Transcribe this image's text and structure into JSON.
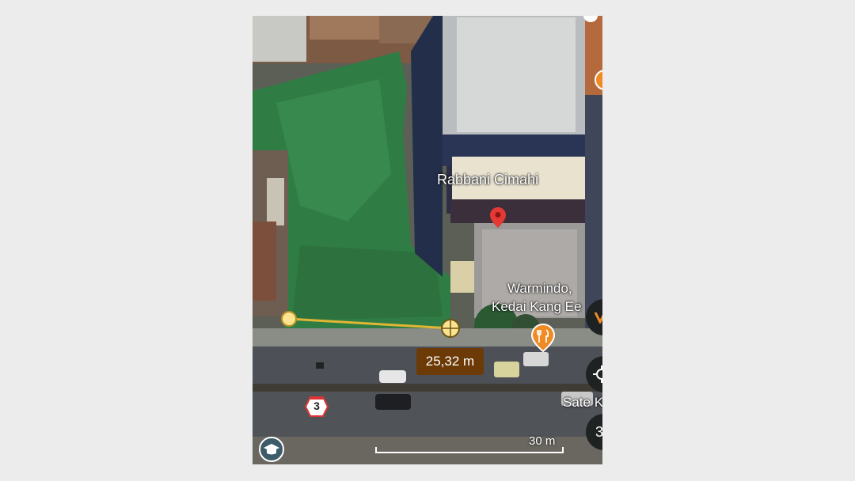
{
  "map": {
    "poi_name": "Rabbani Cimahi",
    "poi2_line1": "Warmindo,",
    "poi2_line2": "Kedai Kang Ee",
    "poi3_partial": "Sate K",
    "route_number": "3",
    "measure_distance": "25,32 m",
    "scale_label": "30 m",
    "side_button_3_text": "3"
  },
  "colors": {
    "pin": "#e53935",
    "food_pin": "#f08a24",
    "measure_line": "#e2b634",
    "measure_box": "#6b3a06"
  },
  "icons": {
    "layers": "graduation-cap-icon",
    "pin": "map-pin-icon",
    "food": "fork-knife-icon",
    "locate": "crosshair-icon"
  }
}
